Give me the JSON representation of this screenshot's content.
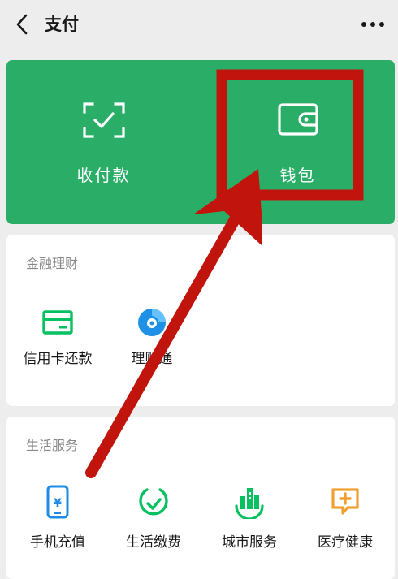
{
  "header": {
    "title": "支付",
    "back_icon": "chevron-left-icon",
    "more_icon": "more-dots-icon"
  },
  "pay_card": {
    "bg_color": "#2aae67",
    "items": [
      {
        "label": "收付款",
        "icon": "scan-check-icon"
      },
      {
        "label": "钱包",
        "icon": "wallet-icon"
      }
    ]
  },
  "finance": {
    "title": "金融理财",
    "items": [
      {
        "label": "信用卡还款",
        "icon": "credit-card-icon",
        "color": "#07c160"
      },
      {
        "label": "理财通",
        "icon": "licaitong-icon",
        "color": "#1e90e6"
      }
    ]
  },
  "life": {
    "title": "生活服务",
    "items": [
      {
        "label": "手机充值",
        "icon": "phone-recharge-icon",
        "color": "#1e8ce6"
      },
      {
        "label": "生活缴费",
        "icon": "bill-check-icon",
        "color": "#07c160"
      },
      {
        "label": "城市服务",
        "icon": "city-building-icon",
        "color": "#07c160"
      },
      {
        "label": "医疗健康",
        "icon": "medical-chat-icon",
        "color": "#f0a030"
      }
    ]
  },
  "annotation": {
    "highlight_color": "#c0140c"
  }
}
